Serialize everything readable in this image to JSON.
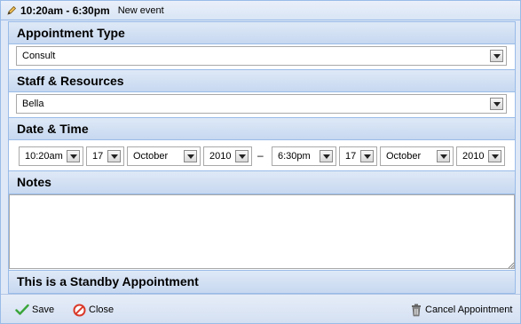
{
  "title_bar": {
    "time_range": "10:20am - 6:30pm",
    "event_label": "New event",
    "icon": "pencil-icon"
  },
  "appointment_type": {
    "heading": "Appointment Type",
    "selected": "Consult"
  },
  "staff_resources": {
    "heading": "Staff & Resources",
    "selected": "Bella"
  },
  "date_time": {
    "heading": "Date & Time",
    "start": {
      "time": "10:20am",
      "day": "17",
      "month": "October",
      "year": "2010"
    },
    "separator": "–",
    "end": {
      "time": "6:30pm",
      "day": "17",
      "month": "October",
      "year": "2010"
    }
  },
  "notes": {
    "heading": "Notes",
    "value": ""
  },
  "standby": {
    "heading": "This is a Standby Appointment"
  },
  "footer": {
    "save_label": "Save",
    "close_label": "Close",
    "cancel_label": "Cancel Appointment",
    "icons": {
      "save": "checkmark-icon",
      "close": "no-entry-icon",
      "cancel": "trash-icon"
    }
  },
  "colors": {
    "header_bg": "#c7d8f0",
    "border": "#99bbe8",
    "save_green": "#3aa53a",
    "close_red": "#d93a2b"
  }
}
